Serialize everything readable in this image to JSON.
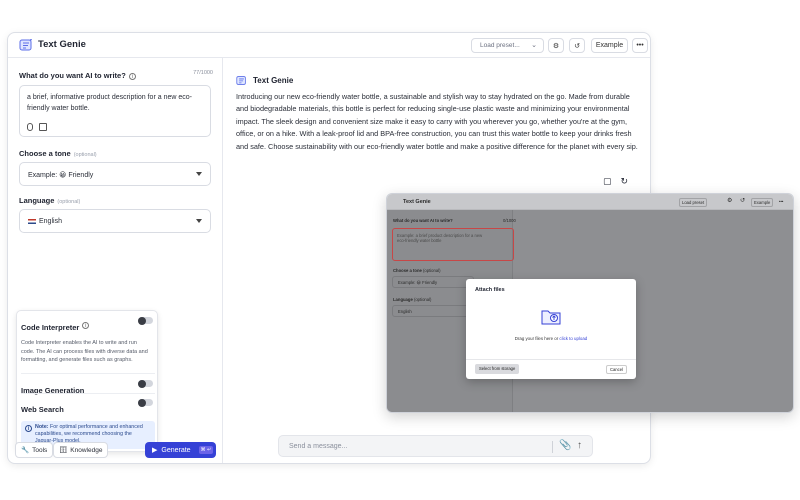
{
  "app": {
    "title": "Text Genie"
  },
  "toolbar": {
    "preset_placeholder": "Load preset...",
    "example_label": "Example"
  },
  "prompt": {
    "label": "What do you want AI to write?",
    "counter": "77/1000",
    "value": "a brief, informative product description for a new eco-friendly water bottle."
  },
  "tone": {
    "label": "Choose a tone",
    "optional": "(optional)",
    "value": "Example: 😀 Friendly"
  },
  "language": {
    "label": "Language",
    "optional": "(optional)",
    "value": "English"
  },
  "tools": {
    "code_interpreter": {
      "name": "Code Interpreter",
      "desc": "Code Interpreter enables the AI to write and run code. The AI can process files with diverse data and formatting, and generate files such as graphs."
    },
    "image_generation": {
      "name": "Image Generation"
    },
    "web_search": {
      "name": "Web Search"
    },
    "note": {
      "label": "Note:",
      "text": "For optimal performance and enhanced capabilities, we recommend choosing the Jaguar-Plus model."
    }
  },
  "bottom": {
    "tools_label": "Tools",
    "knowledge_label": "Knowledge",
    "generate_label": "Generate",
    "generate_kbd": "⌘ ↵"
  },
  "output": {
    "assistant_name": "Text Genie",
    "text": "Introducing our new eco-friendly water bottle, a sustainable and stylish way to stay hydrated on the go. Made from durable and biodegradable materials, this bottle is perfect for reducing single-use plastic waste and minimizing your environmental impact. The sleek design and convenient size make it easy to carry with you wherever you go, whether you're at the gym, office, or on a hike. With a leak-proof lid and BPA-free construction, you can trust this water bottle to keep your drinks fresh and safe. Choose sustainability with our eco-friendly water bottle and make a positive difference for the planet with every sip."
  },
  "message": {
    "placeholder": "Send a message..."
  },
  "overlay": {
    "title": "Text Genie",
    "preset": "Load preset",
    "example": "Example",
    "prompt_label": "What do you want AI to write?",
    "counter": "0/1000",
    "prompt_placeholder": "Example: a brief product description for a new eco-friendly water bottle",
    "tone_label": "Choose a tone",
    "tone_optional": "(optional)",
    "tone_value": "Example: 😀 Friendly",
    "language_label": "Language",
    "language_optional": "(optional)",
    "language_value": "English",
    "dialog": {
      "title": "Attach files",
      "drag_text": "Drag your files here or",
      "upload_link": "click to upload",
      "storage_button": "Select from storage",
      "cancel_button": "Cancel"
    }
  },
  "colors": {
    "accent": "#3541d6",
    "note_bg": "#e7efff",
    "error_border": "#c74747"
  }
}
